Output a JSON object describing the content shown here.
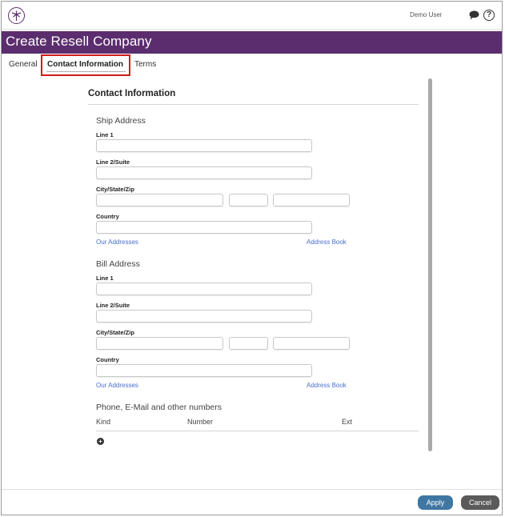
{
  "header": {
    "user": "Demo User"
  },
  "page": {
    "title": "Create Resell Company"
  },
  "tabs": [
    {
      "label": "General"
    },
    {
      "label": "Contact Information"
    },
    {
      "label": "Terms"
    }
  ],
  "contact": {
    "section_title": "Contact Information",
    "ship": {
      "title": "Ship Address",
      "line1_label": "Line 1",
      "line2_label": "Line 2/Suite",
      "csz_label": "City/State/Zip",
      "country_label": "Country",
      "our_addresses": "Our Addresses",
      "address_book": "Address Book"
    },
    "bill": {
      "title": "Bill Address",
      "line1_label": "Line 1",
      "line2_label": "Line 2/Suite",
      "csz_label": "City/State/Zip",
      "country_label": "Country",
      "our_addresses": "Our Addresses",
      "address_book": "Address Book"
    },
    "phone": {
      "title": "Phone, E-Mail and other numbers",
      "columns": [
        "Kind",
        "Number",
        "Ext"
      ]
    }
  },
  "footer": {
    "apply": "Apply",
    "cancel": "Cancel"
  },
  "colors": {
    "brand": "#5b2d6e",
    "highlight": "#d21a1a",
    "link": "#4a6fd1",
    "apply": "#3f77a3",
    "cancel": "#5a5a5a"
  },
  "icons": [
    "logo-icon",
    "chat-icon",
    "help-icon",
    "add-icon"
  ]
}
